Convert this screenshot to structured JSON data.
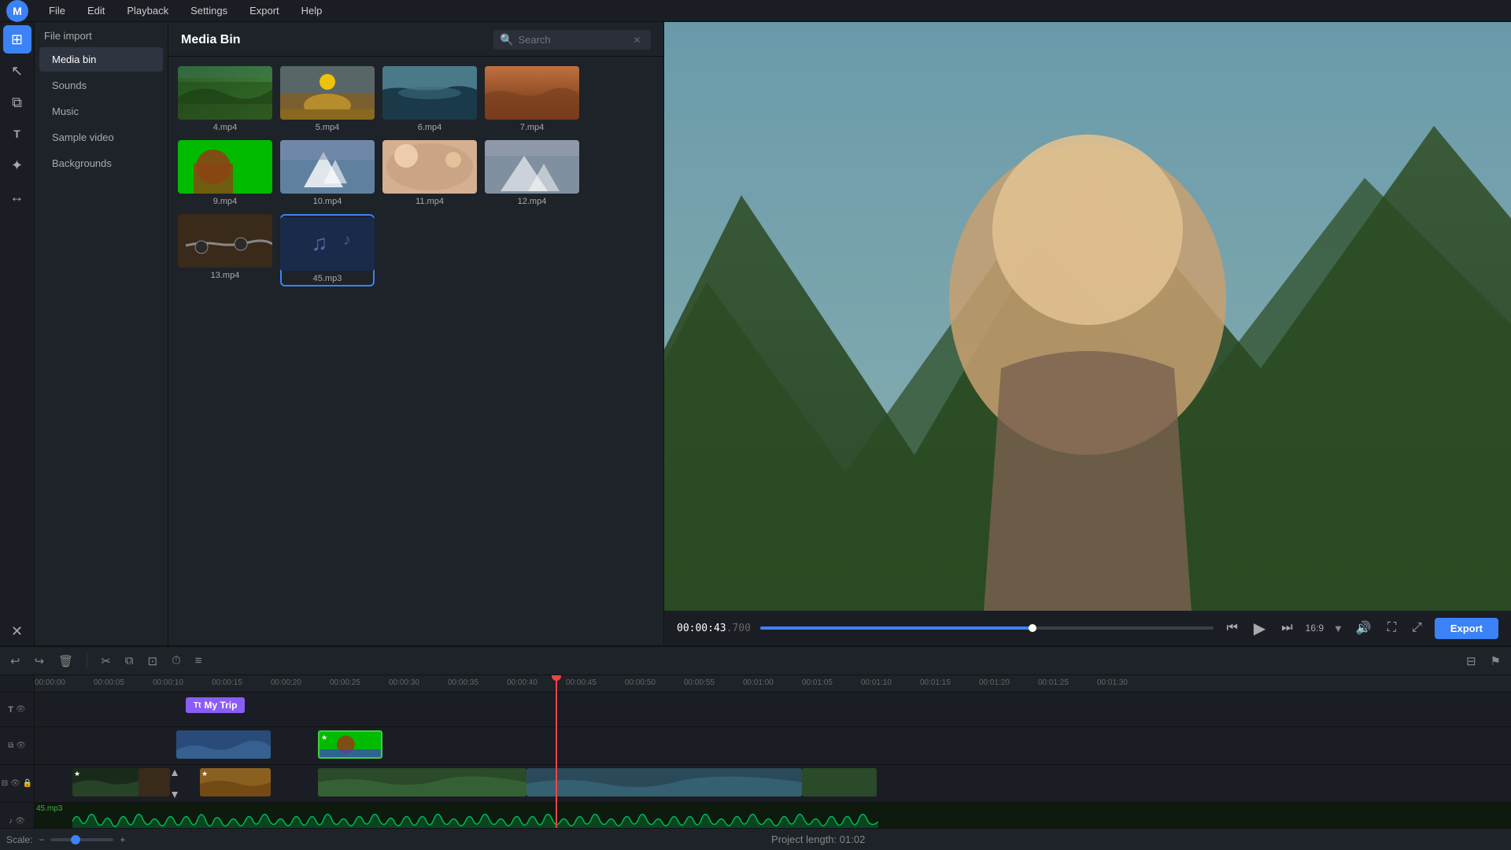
{
  "menubar": {
    "items": [
      "File",
      "Edit",
      "Playback",
      "Settings",
      "Export",
      "Help"
    ]
  },
  "icon_sidebar": {
    "icons": [
      {
        "name": "home-icon",
        "symbol": "⊞",
        "active": true
      },
      {
        "name": "cursor-icon",
        "symbol": "↖",
        "active": false
      },
      {
        "name": "layers-icon",
        "symbol": "⧉",
        "active": false
      },
      {
        "name": "text-icon",
        "symbol": "T",
        "active": false
      },
      {
        "name": "effects-icon",
        "symbol": "✦",
        "active": false
      },
      {
        "name": "transitions-icon",
        "symbol": "↔",
        "active": false
      },
      {
        "name": "close-icon",
        "symbol": "✕",
        "active": false
      }
    ]
  },
  "file_panel": {
    "header": "File import",
    "items": [
      {
        "label": "Media bin",
        "active": true
      },
      {
        "label": "Sounds",
        "active": false
      },
      {
        "label": "Music",
        "active": false
      },
      {
        "label": "Sample video",
        "active": false
      },
      {
        "label": "Backgrounds",
        "active": false
      }
    ]
  },
  "media_bin": {
    "title": "Media Bin",
    "search": {
      "placeholder": "Search",
      "value": ""
    },
    "files": [
      {
        "label": "4.mp4",
        "type": "video",
        "color1": "#2d5a27",
        "color2": "#4a8a3a"
      },
      {
        "label": "5.mp4",
        "type": "video",
        "color1": "#8a6a20",
        "color2": "#c4982a"
      },
      {
        "label": "6.mp4",
        "type": "video",
        "color1": "#2a4a5a",
        "color2": "#3a7a8a"
      },
      {
        "label": "7.mp4",
        "type": "video",
        "color1": "#8a4a20",
        "color2": "#c06030"
      },
      {
        "label": "9.mp4",
        "type": "video",
        "color1": "#00aa00",
        "color2": "#009900"
      },
      {
        "label": "10.mp4",
        "type": "video",
        "color1": "#4a6080",
        "color2": "#6080a0"
      },
      {
        "label": "11.mp4",
        "type": "video",
        "color1": "#c8a080",
        "color2": "#e0c0a0"
      },
      {
        "label": "12.mp4",
        "type": "video",
        "color1": "#8090a0",
        "color2": "#a0b0c0"
      },
      {
        "label": "13.mp4",
        "type": "video",
        "color1": "#3a2a1a",
        "color2": "#5a4a2a"
      },
      {
        "label": "45.mp3",
        "type": "audio",
        "color1": "#1a2a4a",
        "color2": "#2a3a6a"
      }
    ]
  },
  "preview": {
    "time_current": "00:00:43",
    "time_fraction": ".700",
    "aspect_ratio": "16:9",
    "export_label": "Export"
  },
  "timeline": {
    "scale_label": "Scale:",
    "project_length_label": "Project length:",
    "project_length": "01:02",
    "ticks": [
      "00:00:00",
      "00:00:05",
      "00:00:10",
      "00:00:15",
      "00:00:20",
      "00:00:25",
      "00:00:30",
      "00:00:35",
      "00:00:40",
      "00:00:45",
      "00:00:50",
      "00:00:55",
      "00:01:00",
      "00:01:05",
      "00:01:10",
      "00:01:15",
      "00:01:20",
      "00:01:25",
      "00:01:30"
    ],
    "text_clip_label": "My Trip",
    "audio_clip_label": "45.mp3"
  }
}
